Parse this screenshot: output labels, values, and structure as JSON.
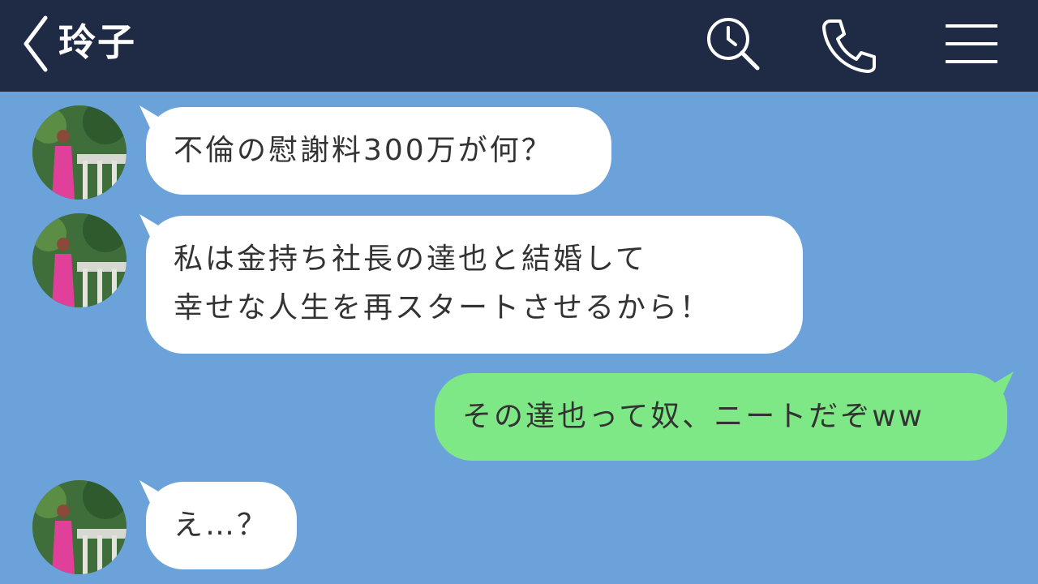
{
  "header": {
    "title": "玲子"
  },
  "icons": {
    "back": "chevron-left-icon",
    "search": "search-clock-icon",
    "call": "phone-icon",
    "menu": "hamburger-menu-icon"
  },
  "colors": {
    "header_bg": "#1f2a44",
    "chat_bg": "#6aa2d9",
    "incoming_bubble": "#ffffff",
    "outgoing_bubble": "#7ee887",
    "text": "#333333"
  },
  "messages": [
    {
      "side": "left",
      "lines": [
        "不倫の慰謝料300万が何？"
      ]
    },
    {
      "side": "left",
      "lines": [
        "私は金持ち社長の達也と結婚して",
        "幸せな人生を再スタートさせるから！"
      ]
    },
    {
      "side": "right",
      "lines": [
        "その達也って奴、ニートだぞww"
      ]
    },
    {
      "side": "left",
      "lines": [
        "え…？"
      ]
    }
  ]
}
